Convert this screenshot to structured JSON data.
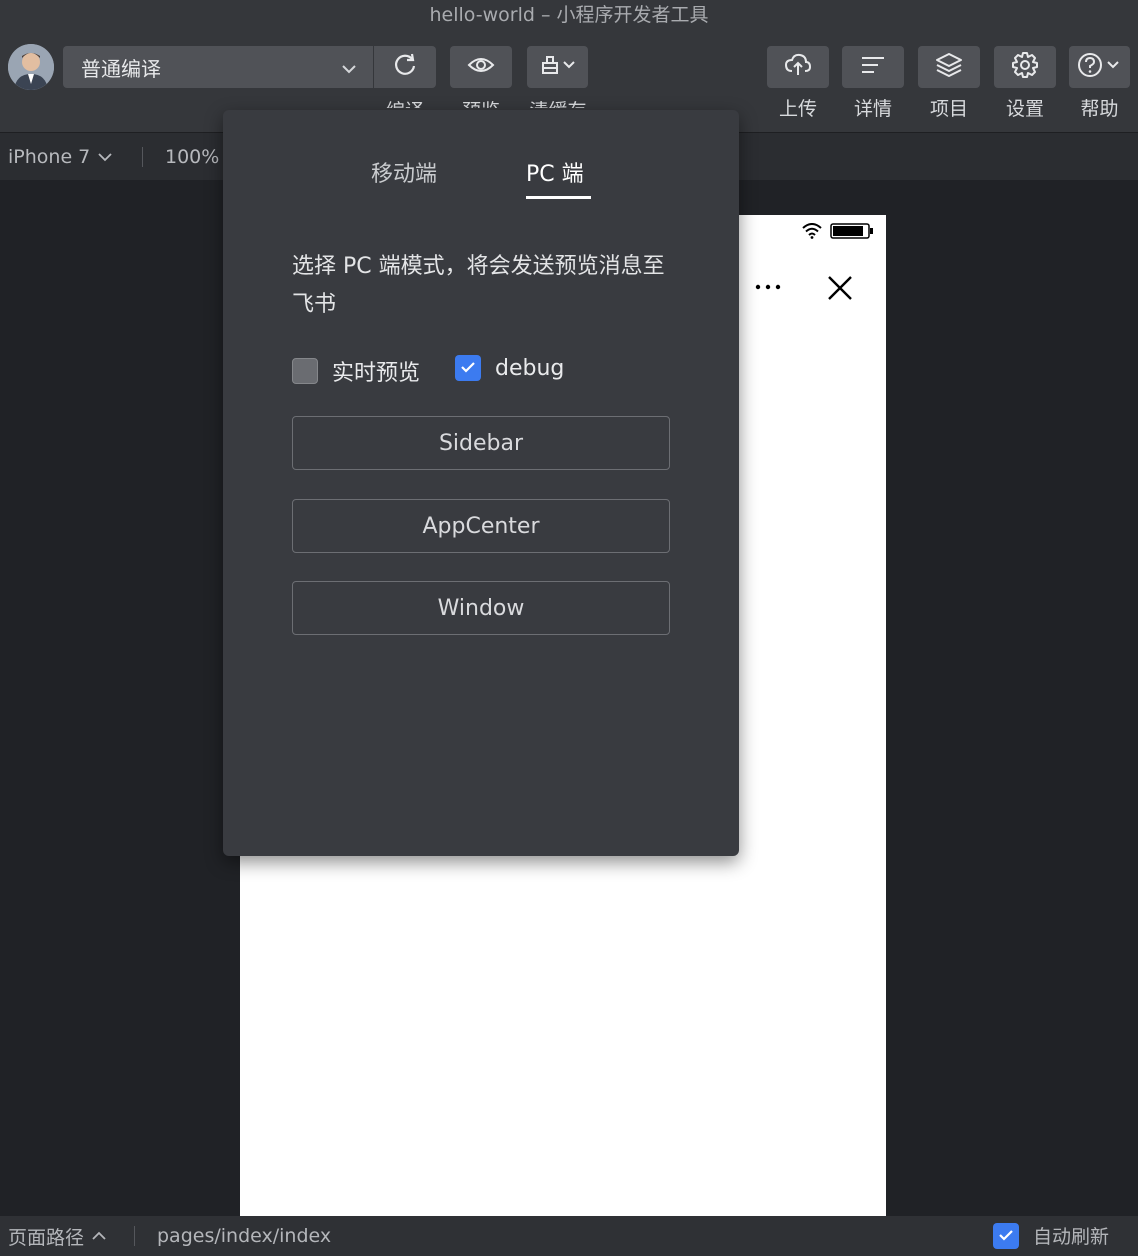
{
  "window": {
    "title": "hello-world – 小程序开发者工具"
  },
  "toolbar": {
    "compile_mode": "普通编译",
    "compile_label": "编译",
    "preview_label": "预览",
    "clear_cache_label": "清缓存",
    "upload_label": "上传",
    "details_label": "详情",
    "project_label": "项目",
    "settings_label": "设置",
    "help_label": "帮助"
  },
  "subbar": {
    "device": "iPhone 7",
    "zoom": "100%"
  },
  "popover": {
    "tabs": [
      {
        "label": "移动端",
        "active": false
      },
      {
        "label": "PC 端",
        "active": true
      }
    ],
    "description": "选择 PC 端模式，将会发送预览消息至飞书",
    "realtime_preview": {
      "label": "实时预览",
      "checked": false
    },
    "debug": {
      "label": "debug",
      "checked": true
    },
    "buttons": [
      "Sidebar",
      "AppCenter",
      "Window"
    ]
  },
  "statusbar": {
    "path_label": "页面路径",
    "path_value": "pages/index/index",
    "auto_refresh_label": "自动刷新",
    "auto_refresh_checked": true
  },
  "colors": {
    "accent": "#3c7bf0",
    "panel": "#393b40",
    "toolbar": "#35373b"
  }
}
